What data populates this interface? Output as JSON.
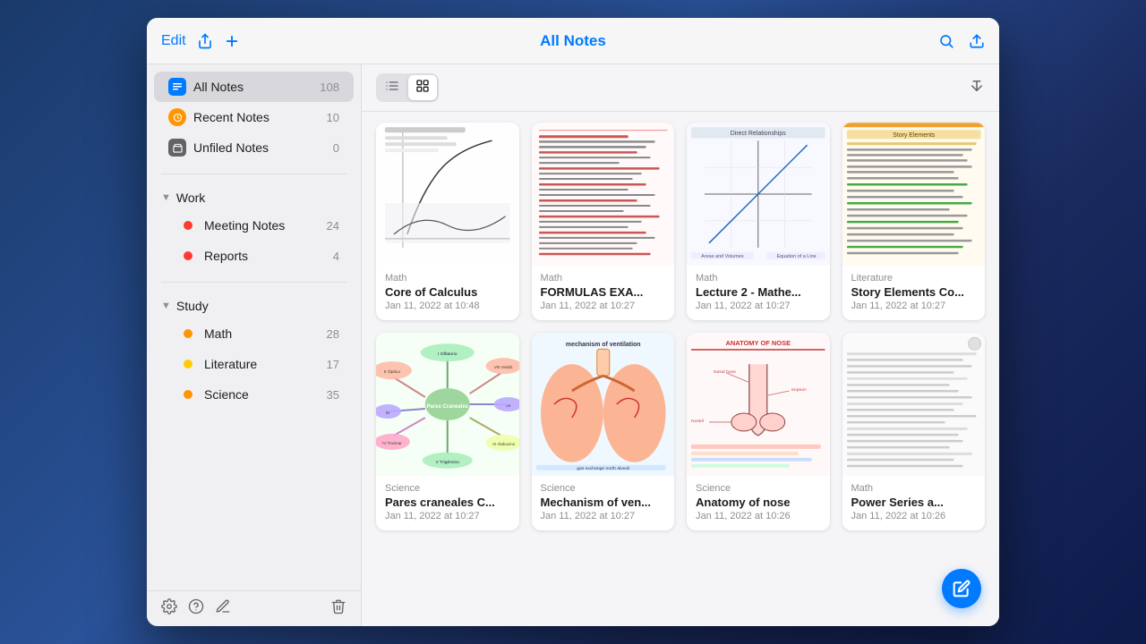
{
  "header": {
    "edit_label": "Edit",
    "title": "All Notes",
    "plus_icon": "+",
    "search_icon": "🔍",
    "export_icon": "⬆"
  },
  "sidebar": {
    "all_notes": {
      "label": "All Notes",
      "count": "108"
    },
    "recent_notes": {
      "label": "Recent Notes",
      "count": "10"
    },
    "unfiled_notes": {
      "label": "Unfiled Notes",
      "count": "0"
    },
    "groups": [
      {
        "label": "Work",
        "children": [
          {
            "label": "Meeting Notes",
            "count": "24",
            "dot": "red"
          },
          {
            "label": "Reports",
            "count": "4",
            "dot": "red"
          }
        ]
      },
      {
        "label": "Study",
        "children": [
          {
            "label": "Math",
            "count": "28",
            "dot": "orange"
          },
          {
            "label": "Literature",
            "count": "17",
            "dot": "yellow"
          },
          {
            "label": "Science",
            "count": "35",
            "dot": "orange"
          }
        ]
      }
    ],
    "footer": {
      "settings_icon": "⚙",
      "help_icon": "?",
      "edit_icon": "✏",
      "trash_icon": "🗑"
    }
  },
  "toolbar": {
    "list_icon": "≡",
    "grid_icon": "⊞",
    "sort_icon": "↕"
  },
  "notes": [
    {
      "category": "Math",
      "title": "Core of Calculus",
      "date": "Jan 11, 2022 at 10:48",
      "thumb_type": "math1"
    },
    {
      "category": "Math",
      "title": "FORMULAS EXA...",
      "date": "Jan 11, 2022 at 10:27",
      "thumb_type": "math2"
    },
    {
      "category": "Math",
      "title": "Lecture 2 - Mathe...",
      "date": "Jan 11, 2022 at 10:27",
      "thumb_type": "math3"
    },
    {
      "category": "Literature",
      "title": "Story Elements Co...",
      "date": "Jan 11, 2022 at 10:27",
      "thumb_type": "lit"
    },
    {
      "category": "Science",
      "title": "Pares craneales C...",
      "date": "Jan 11, 2022 at 10:27",
      "thumb_type": "sci1"
    },
    {
      "category": "Science",
      "title": "Mechanism of ven...",
      "date": "Jan 11, 2022 at 10:27",
      "thumb_type": "sci2"
    },
    {
      "category": "Science",
      "title": "Anatomy of nose",
      "date": "Jan 11, 2022 at 10:26",
      "thumb_type": "sci3"
    },
    {
      "category": "Math",
      "title": "Power Series a...",
      "date": "Jan 11, 2022 at 10:26",
      "thumb_type": "sci4"
    }
  ]
}
